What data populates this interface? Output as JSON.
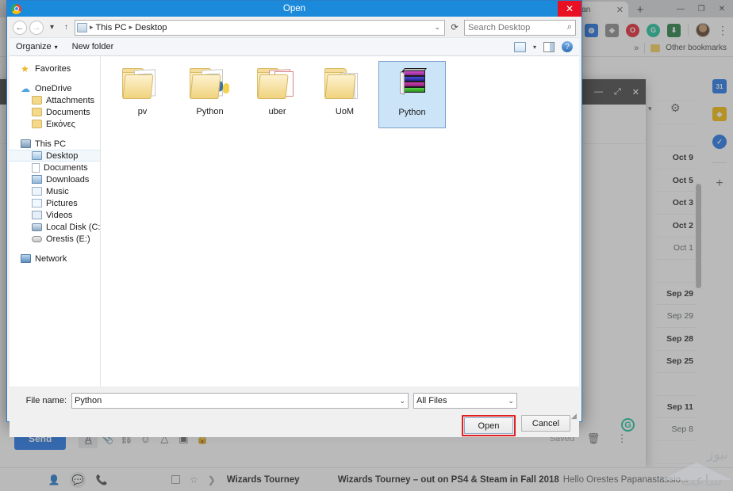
{
  "browser": {
    "tab_title": "nload an",
    "tab_close": "✕",
    "new_tab": "+",
    "window_minimize": "—",
    "window_maximize": "❐",
    "window_close": "✕",
    "menu_dots": "⋮",
    "extensions": [
      {
        "name": "profile-extension-icon",
        "glyph": "⬤",
        "color": "#1a73e8"
      },
      {
        "name": "puzzle-extension-icon",
        "glyph": "◈",
        "color": "#777777"
      },
      {
        "name": "opera-extension-icon",
        "glyph": "O",
        "color": "#e5202e"
      },
      {
        "name": "grammarly-extension-icon",
        "glyph": "G",
        "color": "#15c39a"
      },
      {
        "name": "download-extension-icon",
        "glyph": "⬇",
        "color": "#1e7a3c"
      }
    ],
    "bookmarks_overflow": "»",
    "other_bookmarks": "Other bookmarks"
  },
  "gmail": {
    "gear": "⚙",
    "caret": "▾",
    "dates": [
      {
        "label": "",
        "state": "blank"
      },
      {
        "label": "",
        "state": "blank"
      },
      {
        "label": "Oct 9",
        "state": "unread"
      },
      {
        "label": "Oct 5",
        "state": "unread"
      },
      {
        "label": "Oct 3",
        "state": "unread"
      },
      {
        "label": "Oct 2",
        "state": "unread"
      },
      {
        "label": "Oct 1",
        "state": "read"
      },
      {
        "label": "",
        "state": "blank"
      },
      {
        "label": "Sep 29",
        "state": "unread"
      },
      {
        "label": "Sep 29",
        "state": "read"
      },
      {
        "label": "Sep 28",
        "state": "unread"
      },
      {
        "label": "Sep 25",
        "state": "unread"
      },
      {
        "label": "",
        "state": "blank"
      },
      {
        "label": "Sep 11",
        "state": "unread"
      },
      {
        "label": "Sep 8",
        "state": "read"
      },
      {
        "label": "",
        "state": "blank"
      },
      {
        "label": "",
        "state": "blank"
      }
    ],
    "side_panel": [
      {
        "name": "google-calendar-icon",
        "glyph": "31",
        "color": "#1a73e8"
      },
      {
        "name": "google-keep-icon",
        "glyph": "◆",
        "color": "#f5bb00"
      },
      {
        "name": "google-tasks-icon",
        "glyph": "✓",
        "color": "#1a73e8"
      }
    ],
    "side_panel_add": "+",
    "compose": {
      "minimize": "—",
      "popout": "⤢",
      "close": "✕",
      "send_label": "Send",
      "saved_label": "Saved",
      "toolbar_icons": [
        {
          "name": "text-format-icon",
          "glyph": "A",
          "active": true
        },
        {
          "name": "attach-file-icon",
          "glyph": "📎",
          "active": false
        },
        {
          "name": "insert-link-icon",
          "glyph": "🔗",
          "active": false
        },
        {
          "name": "insert-emoji-icon",
          "glyph": "☺",
          "active": false
        },
        {
          "name": "google-drive-icon",
          "glyph": "△",
          "active": false
        },
        {
          "name": "insert-photo-icon",
          "glyph": "▣",
          "active": false
        },
        {
          "name": "confidential-mode-icon",
          "glyph": "🔒",
          "active": false
        }
      ],
      "discard": "🗑",
      "more_options": "⋮",
      "grammarly": "G"
    },
    "rail_icons": [
      {
        "name": "contacts-icon",
        "glyph": "👤",
        "selected": false
      },
      {
        "name": "chat-icon",
        "glyph": "💬",
        "selected": true
      },
      {
        "name": "calls-icon",
        "glyph": "📞",
        "selected": false
      }
    ],
    "email_row": {
      "checkbox": "",
      "star": "☆",
      "important": "❯",
      "sender": "Wizards Tourney",
      "subject": "Wizards Tourney – out on PS4 & Steam in Fall 2018",
      "separator": "-",
      "snippet": "Hello Orestes Papanastassio..."
    }
  },
  "dialog": {
    "title": "Open",
    "close": "✕",
    "nav": {
      "back": "←",
      "forward": "→",
      "history_caret": "▾",
      "up": "↑",
      "breadcrumbs": [
        "This PC",
        "Desktop"
      ],
      "crumb_sep": "▸",
      "address_dropdown": "⌄",
      "refresh": "⟳",
      "search_placeholder": "Search Desktop",
      "search_value": "",
      "search_icon": "🔍"
    },
    "commands": {
      "organize": "Organize",
      "organize_caret": "▾",
      "new_folder": "New folder",
      "view_caret": "▾",
      "help": "?"
    },
    "sidebar": [
      {
        "label": "Favorites",
        "icon": "star-icon",
        "level": 0,
        "selected": false,
        "gap_after": true
      },
      {
        "label": "OneDrive",
        "icon": "cloud-icon",
        "level": 0,
        "selected": false
      },
      {
        "label": "Attachments",
        "icon": "folder-icon",
        "level": 1,
        "selected": false
      },
      {
        "label": "Documents",
        "icon": "folder-icon",
        "level": 1,
        "selected": false
      },
      {
        "label": "Εικόνες",
        "icon": "folder-icon",
        "level": 1,
        "selected": false,
        "gap_after": true
      },
      {
        "label": "This PC",
        "icon": "computer-icon",
        "level": 0,
        "selected": false
      },
      {
        "label": "Desktop",
        "icon": "desktop-icon",
        "level": 1,
        "selected": true
      },
      {
        "label": "Documents",
        "icon": "documents-icon",
        "level": 1,
        "selected": false
      },
      {
        "label": "Downloads",
        "icon": "downloads-icon",
        "level": 1,
        "selected": false
      },
      {
        "label": "Music",
        "icon": "music-icon",
        "level": 1,
        "selected": false
      },
      {
        "label": "Pictures",
        "icon": "pictures-icon",
        "level": 1,
        "selected": false
      },
      {
        "label": "Videos",
        "icon": "videos-icon",
        "level": 1,
        "selected": false
      },
      {
        "label": "Local Disk (C:)",
        "icon": "disk-icon",
        "level": 1,
        "selected": false
      },
      {
        "label": "Orestis (E:)",
        "icon": "usb-drive-icon",
        "level": 1,
        "selected": false,
        "gap_after": true
      },
      {
        "label": "Network",
        "icon": "network-icon",
        "level": 0,
        "selected": false
      }
    ],
    "files": [
      {
        "name": "pv",
        "type": "folder-image",
        "selected": false
      },
      {
        "name": "Python",
        "type": "folder-python",
        "selected": false
      },
      {
        "name": "uber",
        "type": "folder-pdf",
        "selected": false
      },
      {
        "name": "UoM",
        "type": "folder-docs",
        "selected": false
      },
      {
        "name": "Python",
        "type": "rar-archive",
        "selected": true
      }
    ],
    "footer": {
      "file_name_label": "File name:",
      "file_name_value": "Python",
      "file_name_caret": "⌄",
      "file_type_value": "All Files",
      "file_type_caret": "⌄",
      "open_button": "Open",
      "cancel_button": "Cancel"
    }
  },
  "watermark": {
    "line1": "نیوز",
    "line2": "ساعت"
  }
}
